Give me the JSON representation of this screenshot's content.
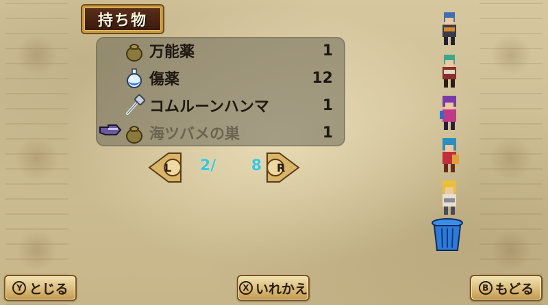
{
  "title": "持ち物",
  "items": [
    {
      "icon": "bag-icon",
      "name": "万能薬",
      "qty": "1",
      "dim": false
    },
    {
      "icon": "potion-flask-icon",
      "name": "傷薬",
      "qty": "12",
      "dim": false
    },
    {
      "icon": "hammer-icon",
      "name": "コムルーンハンマ",
      "qty": "1",
      "dim": false
    },
    {
      "icon": "bag-icon",
      "name": "海ツバメの巣",
      "qty": "1",
      "dim": true
    }
  ],
  "pager": {
    "left_key": "L",
    "right_key": "R",
    "current": "2/",
    "total": "8"
  },
  "party": [
    "character-1",
    "character-2",
    "character-3",
    "character-4",
    "character-5"
  ],
  "buttons": {
    "close": {
      "key": "Y",
      "label": "とじる"
    },
    "swap": {
      "key": "X",
      "label": "いれかえ"
    },
    "back": {
      "key": "B",
      "label": "もどる"
    }
  },
  "colors": {
    "page_text": "#39c6e0",
    "title_plate": "#3a1a0c",
    "panel_border": "#c79a3e"
  }
}
